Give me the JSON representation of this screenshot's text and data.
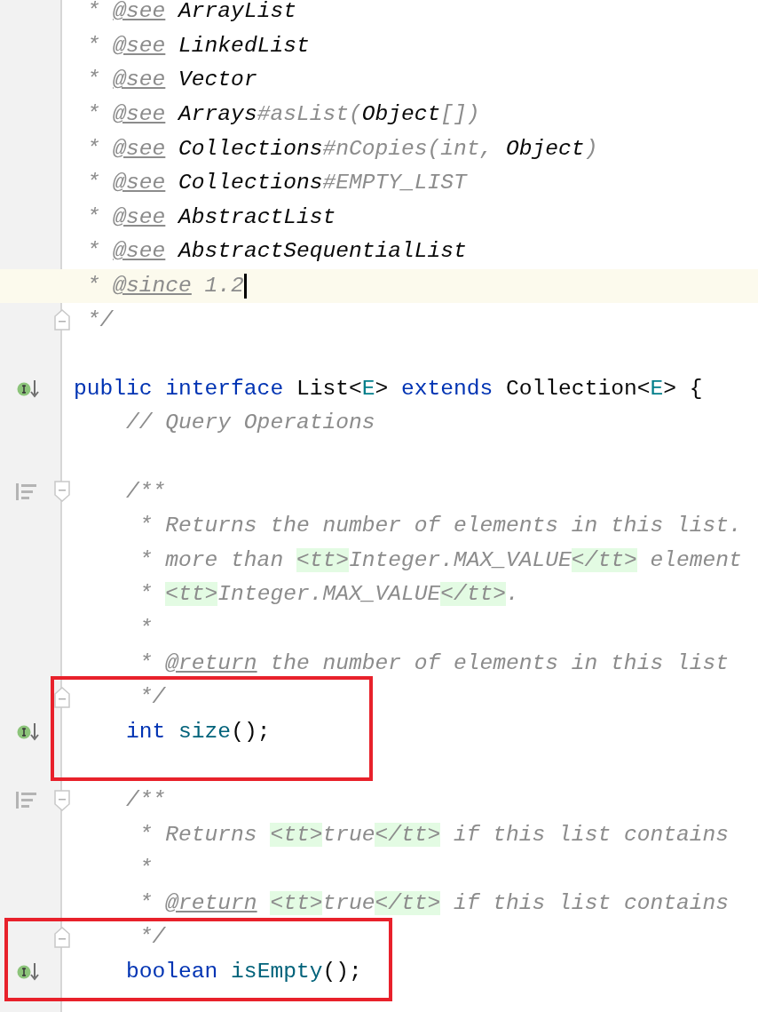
{
  "editor": {
    "lines": [
      {
        "kind": "text",
        "current": false,
        "segments": [
          {
            "kind": "comment",
            "text": " * "
          },
          {
            "kind": "doctag",
            "text": "@see"
          },
          {
            "kind": "docref",
            "text": " ArrayList"
          }
        ]
      },
      {
        "kind": "text",
        "current": false,
        "segments": [
          {
            "kind": "comment",
            "text": " * "
          },
          {
            "kind": "doctag",
            "text": "@see"
          },
          {
            "kind": "docref",
            "text": " LinkedList"
          }
        ]
      },
      {
        "kind": "text",
        "current": false,
        "segments": [
          {
            "kind": "comment",
            "text": " * "
          },
          {
            "kind": "doctag",
            "text": "@see"
          },
          {
            "kind": "docref",
            "text": " Vector"
          }
        ]
      },
      {
        "kind": "text",
        "current": false,
        "segments": [
          {
            "kind": "comment",
            "text": " * "
          },
          {
            "kind": "doctag",
            "text": "@see"
          },
          {
            "kind": "docref",
            "text": " Arrays"
          },
          {
            "kind": "comment",
            "text": "#asList("
          },
          {
            "kind": "docref",
            "text": "Object"
          },
          {
            "kind": "comment",
            "text": "[])"
          }
        ]
      },
      {
        "kind": "text",
        "current": false,
        "segments": [
          {
            "kind": "comment",
            "text": " * "
          },
          {
            "kind": "doctag",
            "text": "@see"
          },
          {
            "kind": "docref",
            "text": " Collections"
          },
          {
            "kind": "comment",
            "text": "#nCopies(int, "
          },
          {
            "kind": "docref",
            "text": "Object"
          },
          {
            "kind": "comment",
            "text": ")"
          }
        ]
      },
      {
        "kind": "text",
        "current": false,
        "segments": [
          {
            "kind": "comment",
            "text": " * "
          },
          {
            "kind": "doctag",
            "text": "@see"
          },
          {
            "kind": "docref",
            "text": " Collections"
          },
          {
            "kind": "comment",
            "text": "#EMPTY_LIST"
          }
        ]
      },
      {
        "kind": "text",
        "current": false,
        "segments": [
          {
            "kind": "comment",
            "text": " * "
          },
          {
            "kind": "doctag",
            "text": "@see"
          },
          {
            "kind": "docref",
            "text": " AbstractList"
          }
        ]
      },
      {
        "kind": "text",
        "current": false,
        "segments": [
          {
            "kind": "comment",
            "text": " * "
          },
          {
            "kind": "doctag",
            "text": "@see"
          },
          {
            "kind": "docref",
            "text": " AbstractSequentialList"
          }
        ]
      },
      {
        "kind": "text",
        "current": true,
        "segments": [
          {
            "kind": "comment",
            "text": " * "
          },
          {
            "kind": "doctag",
            "text": "@since"
          },
          {
            "kind": "comment",
            "text": " 1.2"
          }
        ]
      },
      {
        "kind": "fold_end",
        "current": false,
        "segments": [
          {
            "kind": "comment",
            "text": " */"
          }
        ]
      },
      {
        "kind": "text",
        "current": false
      },
      {
        "kind": "implemented",
        "current": false,
        "segments": [
          {
            "kind": "keyword",
            "text": "public interface "
          },
          {
            "kind": "plain",
            "text": "List<"
          },
          {
            "kind": "typeparam",
            "text": "E"
          },
          {
            "kind": "plain",
            "text": "> "
          },
          {
            "kind": "keyword",
            "text": "extends "
          },
          {
            "kind": "plain",
            "text": "Collection<"
          },
          {
            "kind": "typeparam",
            "text": "E"
          },
          {
            "kind": "plain",
            "text": "> {"
          }
        ]
      },
      {
        "kind": "text",
        "current": false,
        "segments": [
          {
            "kind": "comment",
            "text": "    // Query Operations"
          }
        ]
      },
      {
        "kind": "text",
        "current": false
      },
      {
        "kind": "doc_start",
        "current": false,
        "segments": [
          {
            "kind": "comment",
            "text": "    /**"
          }
        ]
      },
      {
        "kind": "text",
        "current": false,
        "segments": [
          {
            "kind": "comment",
            "text": "     * Returns the number of elements in this list."
          }
        ]
      },
      {
        "kind": "text",
        "current": false,
        "segments": [
          {
            "kind": "comment",
            "text": "     * more than "
          },
          {
            "kind": "html",
            "text": "<tt>"
          },
          {
            "kind": "comment",
            "text": "Integer.MAX_VALUE"
          },
          {
            "kind": "html",
            "text": "</tt>"
          },
          {
            "kind": "comment",
            "text": " element"
          }
        ]
      },
      {
        "kind": "text",
        "current": false,
        "segments": [
          {
            "kind": "comment",
            "text": "     * "
          },
          {
            "kind": "html",
            "text": "<tt>"
          },
          {
            "kind": "comment",
            "text": "Integer.MAX_VALUE"
          },
          {
            "kind": "html",
            "text": "</tt>"
          },
          {
            "kind": "comment",
            "text": "."
          }
        ]
      },
      {
        "kind": "text",
        "current": false,
        "segments": [
          {
            "kind": "comment",
            "text": "     *"
          }
        ]
      },
      {
        "kind": "text",
        "current": false,
        "segments": [
          {
            "kind": "comment",
            "text": "     * "
          },
          {
            "kind": "doctag",
            "text": "@return"
          },
          {
            "kind": "comment",
            "text": " the number of elements in this list"
          }
        ]
      },
      {
        "kind": "fold_end",
        "current": false,
        "segments": [
          {
            "kind": "comment",
            "text": "     */"
          }
        ]
      },
      {
        "kind": "implemented",
        "current": false,
        "segments": [
          {
            "kind": "keyword",
            "text": "    int "
          },
          {
            "kind": "method",
            "text": "size"
          },
          {
            "kind": "plain",
            "text": "();"
          }
        ]
      },
      {
        "kind": "text",
        "current": false
      },
      {
        "kind": "doc_start",
        "current": false,
        "segments": [
          {
            "kind": "comment",
            "text": "    /**"
          }
        ]
      },
      {
        "kind": "text",
        "current": false,
        "segments": [
          {
            "kind": "comment",
            "text": "     * Returns "
          },
          {
            "kind": "html",
            "text": "<tt>"
          },
          {
            "kind": "comment",
            "text": "true"
          },
          {
            "kind": "html",
            "text": "</tt>"
          },
          {
            "kind": "comment",
            "text": " if this list contains"
          }
        ]
      },
      {
        "kind": "text",
        "current": false,
        "segments": [
          {
            "kind": "comment",
            "text": "     *"
          }
        ]
      },
      {
        "kind": "text",
        "current": false,
        "segments": [
          {
            "kind": "comment",
            "text": "     * "
          },
          {
            "kind": "doctag",
            "text": "@return"
          },
          {
            "kind": "html",
            "text": "<tt>",
            "space_before": true
          },
          {
            "kind": "comment",
            "text": "true"
          },
          {
            "kind": "html",
            "text": "</tt>"
          },
          {
            "kind": "comment",
            "text": " if this list contains"
          }
        ]
      },
      {
        "kind": "fold_end",
        "current": false,
        "segments": [
          {
            "kind": "comment",
            "text": "     */"
          }
        ]
      },
      {
        "kind": "implemented",
        "current": false,
        "segments": [
          {
            "kind": "keyword",
            "text": "    boolean "
          },
          {
            "kind": "method",
            "text": "isEmpty"
          },
          {
            "kind": "plain",
            "text": "();"
          }
        ]
      },
      {
        "kind": "text",
        "current": false
      }
    ]
  },
  "annotation_boxes": [
    {
      "kind": "rectangle"
    },
    {
      "kind": "rectangle"
    }
  ]
}
